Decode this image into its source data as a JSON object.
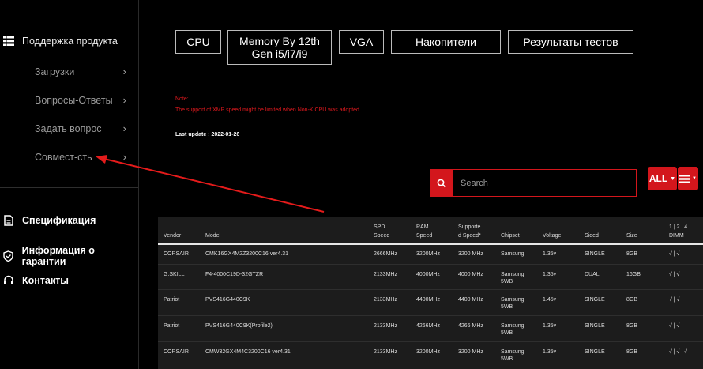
{
  "sidebar": {
    "header": "Поддержка продукта",
    "subitems": [
      {
        "label": "Загрузки"
      },
      {
        "label": "Вопросы-Ответы"
      },
      {
        "label": "Задать вопрос"
      },
      {
        "label": "Совмест-сть"
      }
    ],
    "links": [
      {
        "label": "Спецификация",
        "icon": "document-icon"
      },
      {
        "label": "Информация о гарантии",
        "icon": "shield-check-icon"
      },
      {
        "label": "Контакты",
        "icon": "headset-icon"
      }
    ]
  },
  "tabs": [
    {
      "label": "CPU"
    },
    {
      "label": "Memory By 12th Gen i5/i7/i9"
    },
    {
      "label": "VGA"
    },
    {
      "label": "Накопители"
    },
    {
      "label": "Результаты тестов"
    }
  ],
  "note": {
    "title": "Note:",
    "text": "The support of XMP speed might be limited when Non-K CPU was adopted."
  },
  "last_update": "Last update : 2022-01-26",
  "search": {
    "placeholder": "Search"
  },
  "filter": {
    "label": "ALL"
  },
  "colors": {
    "accent": "#d3161c",
    "note": "#e0191e"
  },
  "table": {
    "headers": {
      "vendor": "Vendor",
      "model": "Model",
      "spd_1": "SPD",
      "spd_2": "Speed",
      "ram_1": "RAM",
      "ram_2": "Speed",
      "sup_1": "Supporte",
      "sup_2": "d Speed*",
      "chipset": "Chipset",
      "voltage": "Voltage",
      "sided": "Sided",
      "size": "Size",
      "dimm_1": "1 | 2 | 4",
      "dimm_2": "DIMM"
    },
    "rows": [
      {
        "vendor": "CORSAIR",
        "model": "CMK16GX4M2Z3200C16 ver4.31",
        "spd": "2666MHz",
        "ram": "3200MHz",
        "sup": "3200 MHz",
        "chipset_1": "Samsung",
        "chipset_2": "",
        "voltage": "1.35v",
        "sided": "SINGLE",
        "size": "8GB",
        "dimm": "√ | √ |"
      },
      {
        "vendor": "G.SKILL",
        "model": "F4-4000C19D-32GTZR",
        "spd": "2133MHz",
        "ram": "4000MHz",
        "sup": "4000 MHz",
        "chipset_1": "Samsung",
        "chipset_2": "5WB",
        "voltage": "1.35v",
        "sided": "DUAL",
        "size": "16GB",
        "dimm": "√ | √ |"
      },
      {
        "vendor": "Patriot",
        "model": "PVS416G440C9K",
        "spd": "2133MHz",
        "ram": "4400MHz",
        "sup": "4400 MHz",
        "chipset_1": "Samsung",
        "chipset_2": "5WB",
        "voltage": "1.45v",
        "sided": "SINGLE",
        "size": "8GB",
        "dimm": "√ | √ |"
      },
      {
        "vendor": "Patriot",
        "model": "PVS416G440C9K(Profile2)",
        "spd": "2133MHz",
        "ram": "4266MHz",
        "sup": "4266 MHz",
        "chipset_1": "Samsung",
        "chipset_2": "5WB",
        "voltage": "1.35v",
        "sided": "SINGLE",
        "size": "8GB",
        "dimm": "√ | √ |"
      },
      {
        "vendor": "CORSAIR",
        "model": "CMW32GX4M4C3200C16 ver4.31",
        "spd": "2133MHz",
        "ram": "3200MHz",
        "sup": "3200 MHz",
        "chipset_1": "Samsung",
        "chipset_2": "5WB",
        "voltage": "1.35v",
        "sided": "SINGLE",
        "size": "8GB",
        "dimm": "√ | √ | √"
      }
    ]
  }
}
